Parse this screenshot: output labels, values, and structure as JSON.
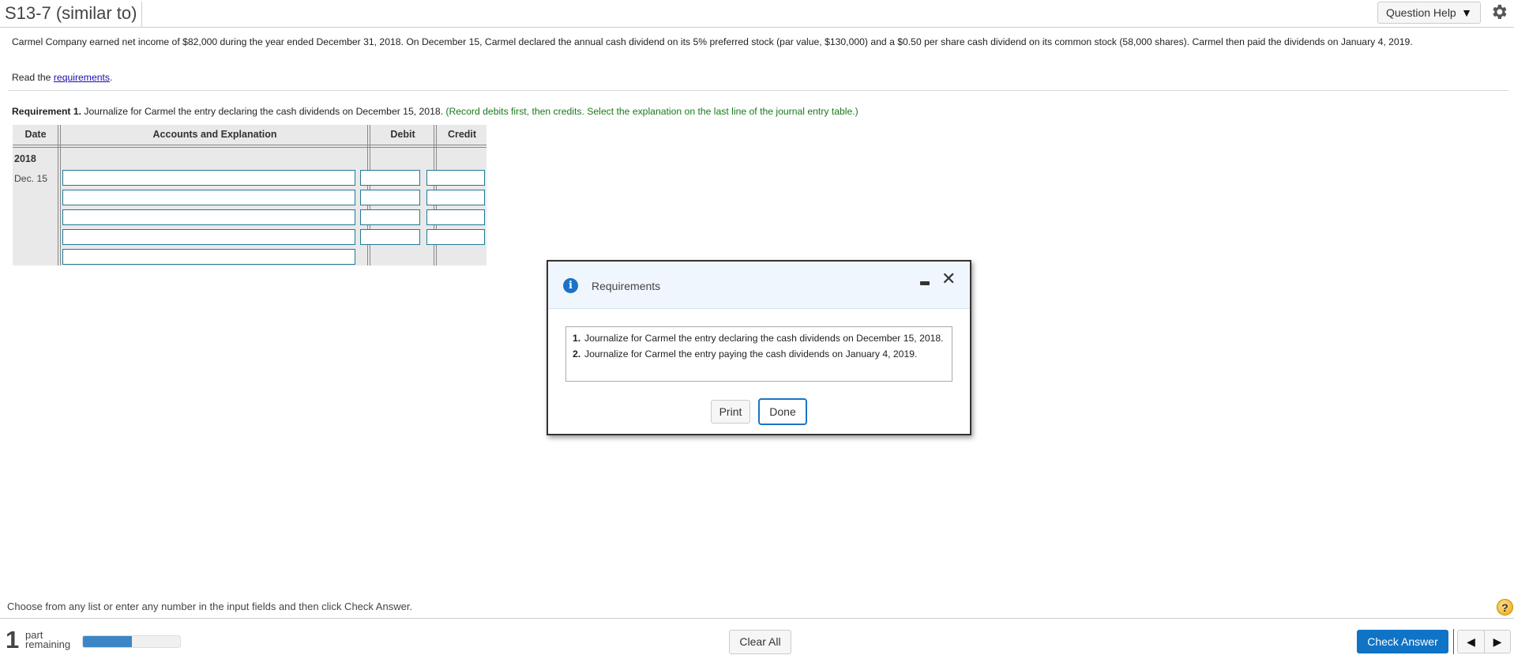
{
  "header": {
    "title": "S13-7 (similar to)",
    "question_help_label": "Question Help",
    "question_help_icon": "caret-down-icon",
    "settings_icon": "gear-icon"
  },
  "problem": {
    "text": "Carmel Company earned net income of $82,000 during the year ended December 31, 2018. On December 15, Carmel declared the annual cash dividend on its 5% preferred stock (par value, $130,000) and a $0.50 per share cash dividend on its common stock (58,000 shares). Carmel then paid the dividends on January 4, 2019.",
    "read_prefix": "Read the ",
    "read_link": "requirements",
    "read_suffix": "."
  },
  "requirement": {
    "label": "Requirement 1.",
    "text": " Journalize for Carmel the entry declaring the cash dividends on December 15, 2018. ",
    "hint": "(Record debits first, then credits. Select the explanation on the last line of the journal entry table.)"
  },
  "journal": {
    "headers": {
      "date": "Date",
      "accounts": "Accounts and Explanation",
      "debit": "Debit",
      "credit": "Credit"
    },
    "year": "2018",
    "date_label": "Dec. 15",
    "rows": [
      {
        "account": "",
        "debit": "",
        "credit": ""
      },
      {
        "account": "",
        "debit": "",
        "credit": ""
      },
      {
        "account": "",
        "debit": "",
        "credit": ""
      },
      {
        "account": "",
        "debit": "",
        "credit": ""
      }
    ],
    "explanation": ""
  },
  "modal": {
    "title": "Requirements",
    "icon": "info-icon",
    "items": [
      {
        "num": "1.",
        "text": "Journalize for Carmel the entry declaring the cash dividends on December 15, 2018."
      },
      {
        "num": "2.",
        "text": "Journalize for Carmel the entry paying the cash dividends on January 4, 2019."
      }
    ],
    "print_label": "Print",
    "done_label": "Done"
  },
  "footer": {
    "instructions": "Choose from any list or enter any number in the input fields and then click Check Answer.",
    "parts_remaining_count": "1",
    "parts_remaining_label_1": "part",
    "parts_remaining_label_2": "remaining",
    "progress_percent": 50,
    "clear_all_label": "Clear All",
    "check_answer_label": "Check Answer",
    "help_symbol": "?",
    "prev_symbol": "◀",
    "next_symbol": "▶"
  }
}
